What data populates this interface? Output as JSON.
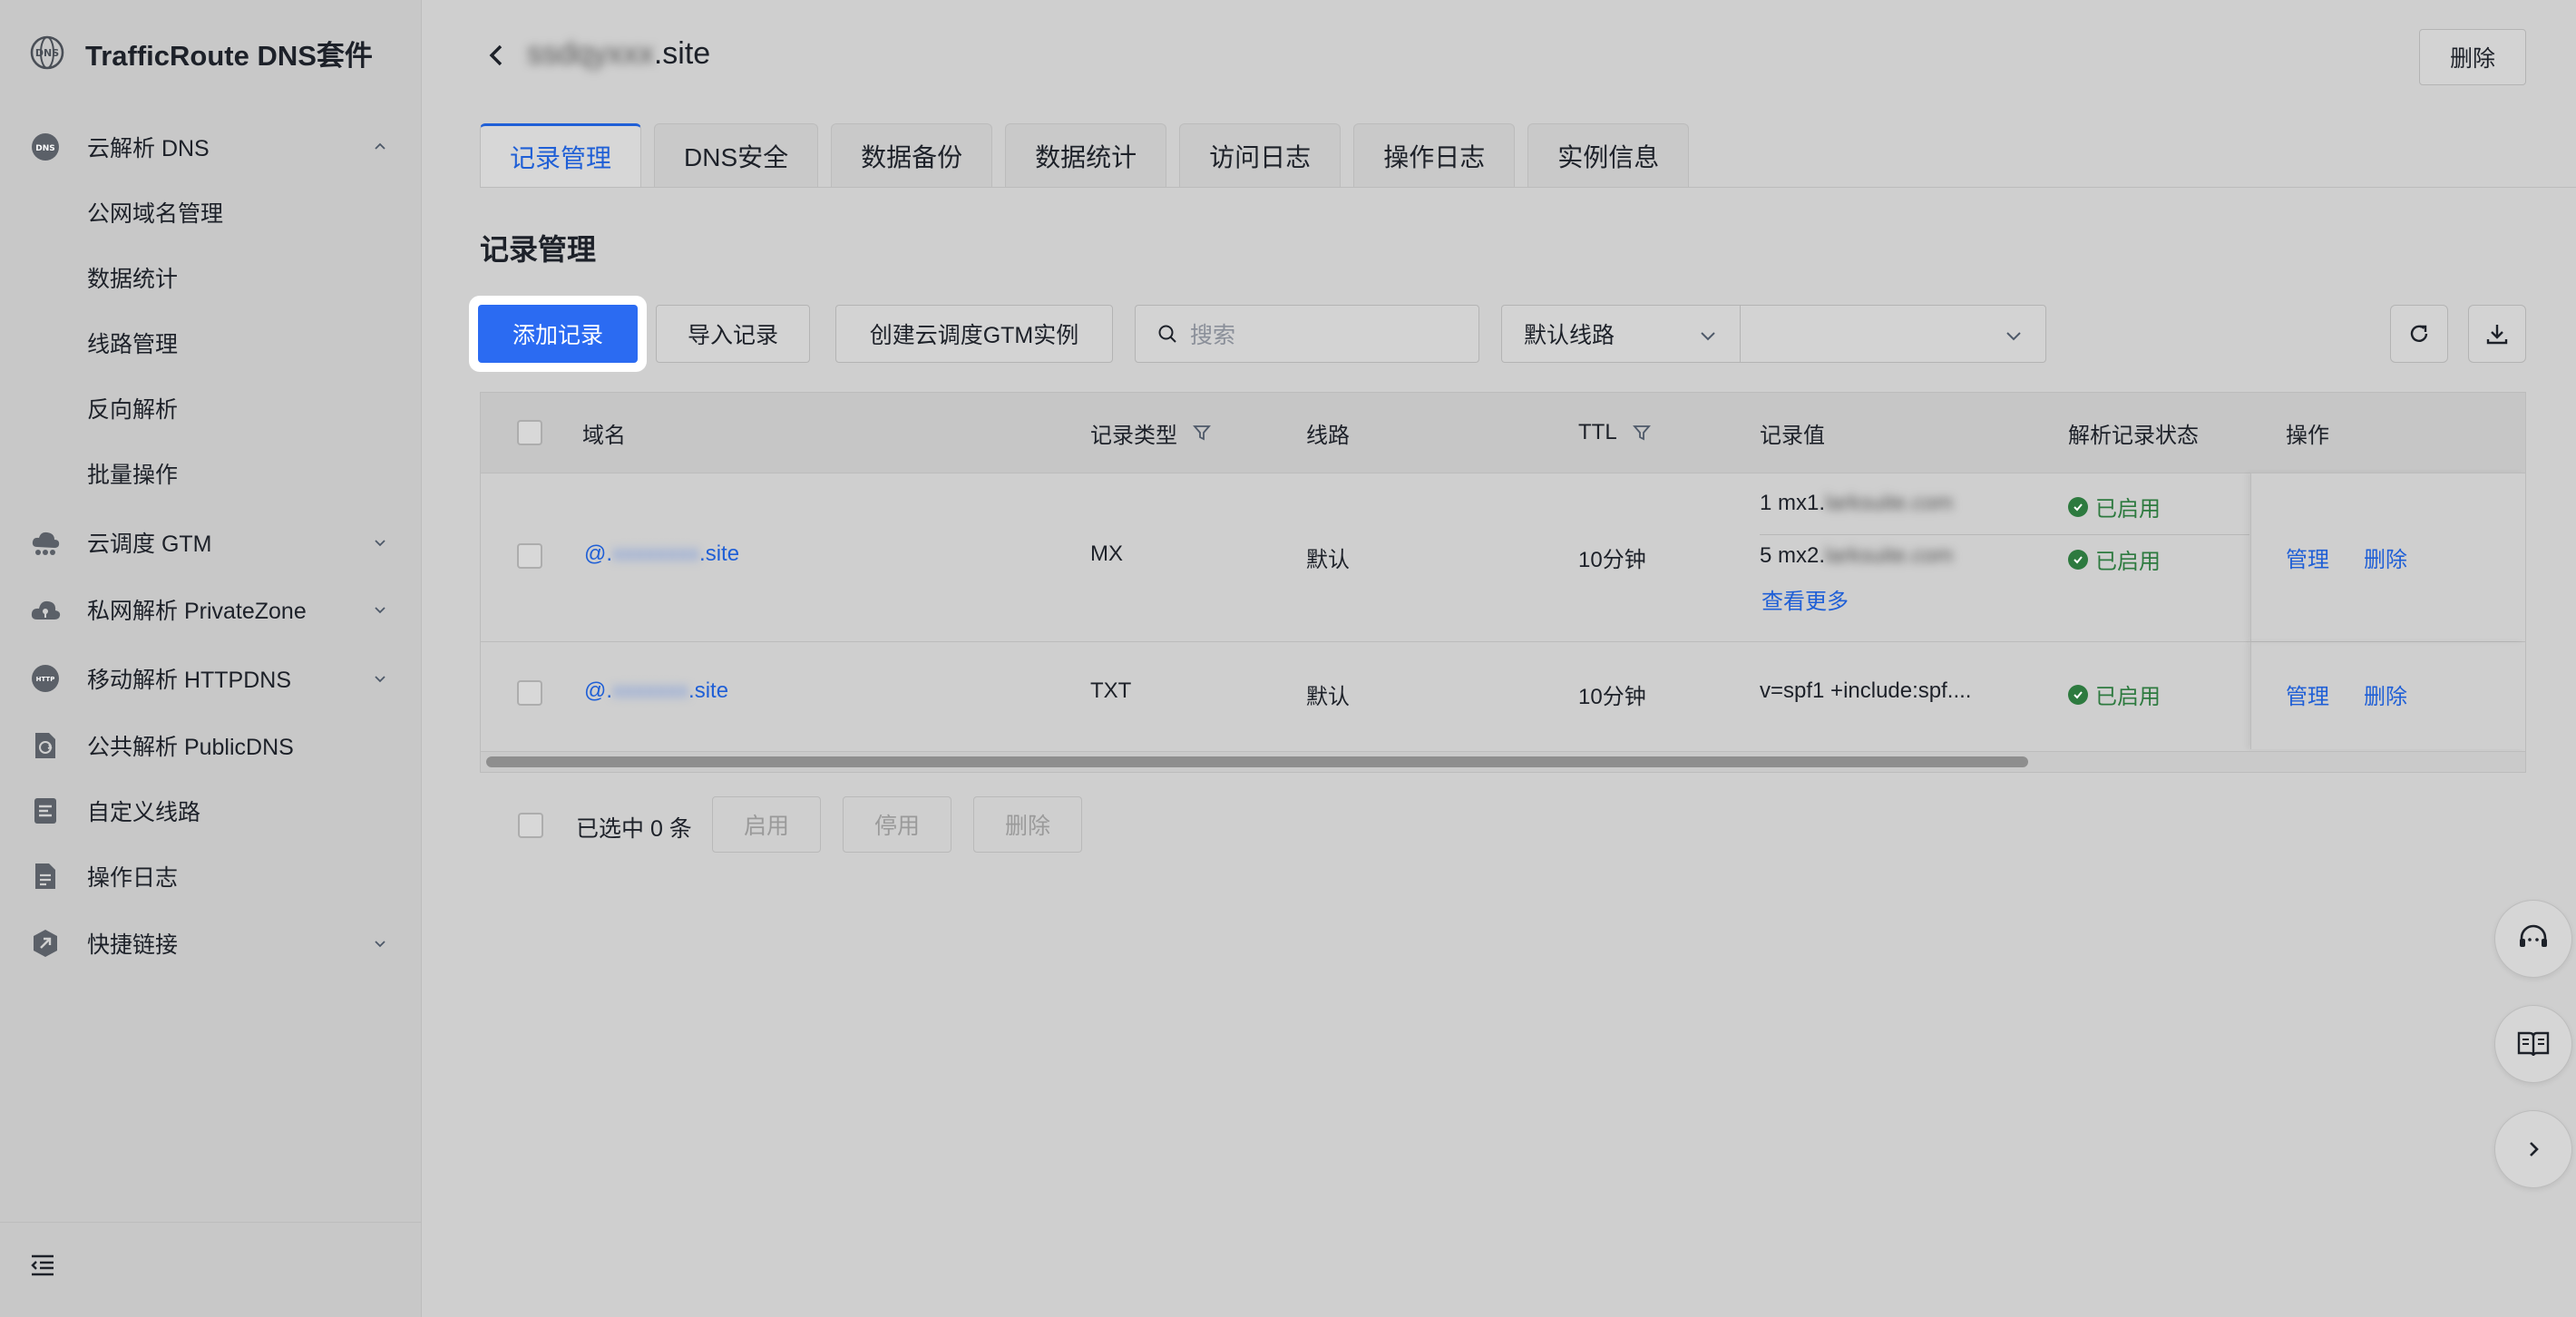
{
  "app": {
    "title": "TrafficRoute DNS套件"
  },
  "sidebar": {
    "items": [
      {
        "label": "云解析 DNS",
        "icon": "dns-icon",
        "expanded": true
      },
      {
        "label": "公网域名管理"
      },
      {
        "label": "数据统计"
      },
      {
        "label": "线路管理"
      },
      {
        "label": "反向解析"
      },
      {
        "label": "批量操作"
      },
      {
        "label": "云调度 GTM",
        "icon": "cloud-icon"
      },
      {
        "label": "私网解析 PrivateZone",
        "icon": "private-cloud-icon"
      },
      {
        "label": "移动解析 HTTPDNS",
        "icon": "http-icon"
      },
      {
        "label": "公共解析 PublicDNS",
        "icon": "public-dns-icon"
      },
      {
        "label": "自定义线路",
        "icon": "custom-route-icon"
      },
      {
        "label": "操作日志",
        "icon": "log-icon"
      },
      {
        "label": "快捷链接",
        "icon": "link-icon"
      }
    ]
  },
  "header": {
    "domain_blurred": "ssdqyxxx",
    "domain_suffix": ".site",
    "delete_label": "删除"
  },
  "tabs": [
    "记录管理",
    "DNS安全",
    "数据备份",
    "数据统计",
    "访问日志",
    "操作日志",
    "实例信息"
  ],
  "section_title": "记录管理",
  "toolbar": {
    "add_label": "添加记录",
    "import_label": "导入记录",
    "gtm_label": "创建云调度GTM实例",
    "search_placeholder": "搜索",
    "route_select": "默认线路"
  },
  "table": {
    "headers": [
      "域名",
      "记录类型",
      "线路",
      "TTL",
      "记录值",
      "解析记录状态",
      "操作"
    ],
    "rows": [
      {
        "domain_prefix": "@.",
        "domain_blur": "xxxxxxxx",
        "domain_suffix": ".site",
        "type": "MX",
        "route": "默认",
        "ttl": "10分钟",
        "values": [
          {
            "prefix": "1 mx1.",
            "blur": "larksuite.com",
            "status": "已启用"
          },
          {
            "prefix": "5 mx2.",
            "blur": "larksuite.com",
            "status": "已启用"
          }
        ],
        "more": "查看更多",
        "manage": "管理",
        "delete": "删除"
      },
      {
        "domain_prefix": "@.",
        "domain_blur": "xxxxxxx",
        "domain_suffix": ".site",
        "type": "TXT",
        "route": "默认",
        "ttl": "10分钟",
        "value": "v=spf1 +include:spf....",
        "status": "已启用",
        "manage": "管理",
        "delete": "删除"
      }
    ]
  },
  "bottom": {
    "selected": "已选中 0 条",
    "enable": "启用",
    "disable": "停用",
    "delete": "删除"
  },
  "colors": {
    "primary": "#2b6bf2",
    "link": "#1f5fd6",
    "success": "#2d7a3f"
  }
}
